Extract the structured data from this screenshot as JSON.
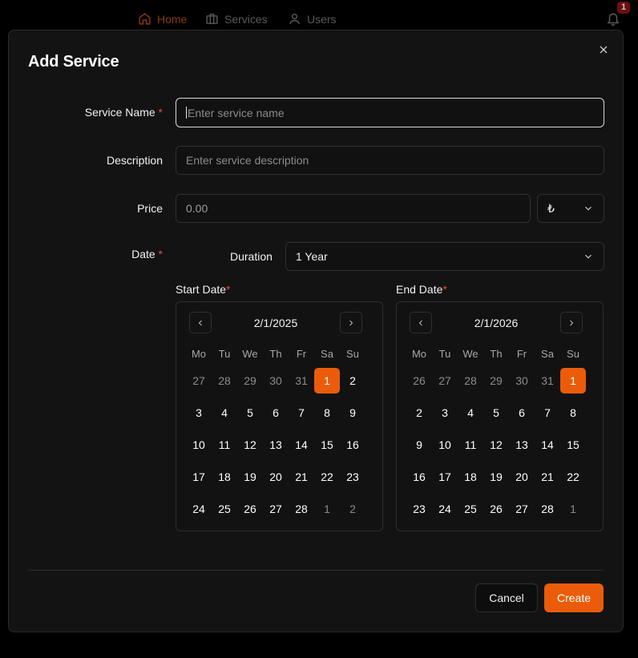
{
  "nav": {
    "home_label": "Home",
    "services_label": "Services",
    "users_label": "Users",
    "notification_count": "1"
  },
  "modal": {
    "title": "Add Service",
    "service_name": {
      "label": "Service Name",
      "placeholder": "Enter service name",
      "required_mark": "*"
    },
    "description": {
      "label": "Description",
      "placeholder": "Enter service description"
    },
    "price": {
      "label": "Price",
      "value": "0.00",
      "currency": "₺"
    },
    "date": {
      "label": "Date",
      "required_mark": "*"
    },
    "duration": {
      "label": "Duration",
      "value": "1 Year"
    },
    "start_date": {
      "label": "Start Date",
      "required_mark": "*",
      "title": "2/1/2025",
      "weekdays": [
        "Mo",
        "Tu",
        "We",
        "Th",
        "Fr",
        "Sa",
        "Su"
      ],
      "days": [
        {
          "d": "27",
          "out": true
        },
        {
          "d": "28",
          "out": true
        },
        {
          "d": "29",
          "out": true
        },
        {
          "d": "30",
          "out": true
        },
        {
          "d": "31",
          "out": true
        },
        {
          "d": "1",
          "sel": true
        },
        {
          "d": "2"
        },
        {
          "d": "3"
        },
        {
          "d": "4"
        },
        {
          "d": "5"
        },
        {
          "d": "6"
        },
        {
          "d": "7"
        },
        {
          "d": "8"
        },
        {
          "d": "9"
        },
        {
          "d": "10"
        },
        {
          "d": "11"
        },
        {
          "d": "12"
        },
        {
          "d": "13"
        },
        {
          "d": "14"
        },
        {
          "d": "15"
        },
        {
          "d": "16"
        },
        {
          "d": "17"
        },
        {
          "d": "18"
        },
        {
          "d": "19"
        },
        {
          "d": "20"
        },
        {
          "d": "21"
        },
        {
          "d": "22"
        },
        {
          "d": "23"
        },
        {
          "d": "24"
        },
        {
          "d": "25"
        },
        {
          "d": "26"
        },
        {
          "d": "27"
        },
        {
          "d": "28"
        },
        {
          "d": "1",
          "out": true
        },
        {
          "d": "2",
          "out": true
        }
      ]
    },
    "end_date": {
      "label": "End Date",
      "required_mark": "*",
      "title": "2/1/2026",
      "weekdays": [
        "Mo",
        "Tu",
        "We",
        "Th",
        "Fr",
        "Sa",
        "Su"
      ],
      "days": [
        {
          "d": "26",
          "out": true
        },
        {
          "d": "27",
          "out": true
        },
        {
          "d": "28",
          "out": true
        },
        {
          "d": "29",
          "out": true
        },
        {
          "d": "30",
          "out": true
        },
        {
          "d": "31",
          "out": true
        },
        {
          "d": "1",
          "sel": true
        },
        {
          "d": "2"
        },
        {
          "d": "3"
        },
        {
          "d": "4"
        },
        {
          "d": "5"
        },
        {
          "d": "6"
        },
        {
          "d": "7"
        },
        {
          "d": "8"
        },
        {
          "d": "9"
        },
        {
          "d": "10"
        },
        {
          "d": "11"
        },
        {
          "d": "12"
        },
        {
          "d": "13"
        },
        {
          "d": "14"
        },
        {
          "d": "15"
        },
        {
          "d": "16"
        },
        {
          "d": "17"
        },
        {
          "d": "18"
        },
        {
          "d": "19"
        },
        {
          "d": "20"
        },
        {
          "d": "21"
        },
        {
          "d": "22"
        },
        {
          "d": "23"
        },
        {
          "d": "24"
        },
        {
          "d": "25"
        },
        {
          "d": "26"
        },
        {
          "d": "27"
        },
        {
          "d": "28"
        },
        {
          "d": "1",
          "out": true
        }
      ]
    },
    "cancel_label": "Cancel",
    "create_label": "Create"
  },
  "colors": {
    "accent": "#ea5c0a",
    "required": "#e44b3b",
    "modal_bg": "#131313"
  }
}
